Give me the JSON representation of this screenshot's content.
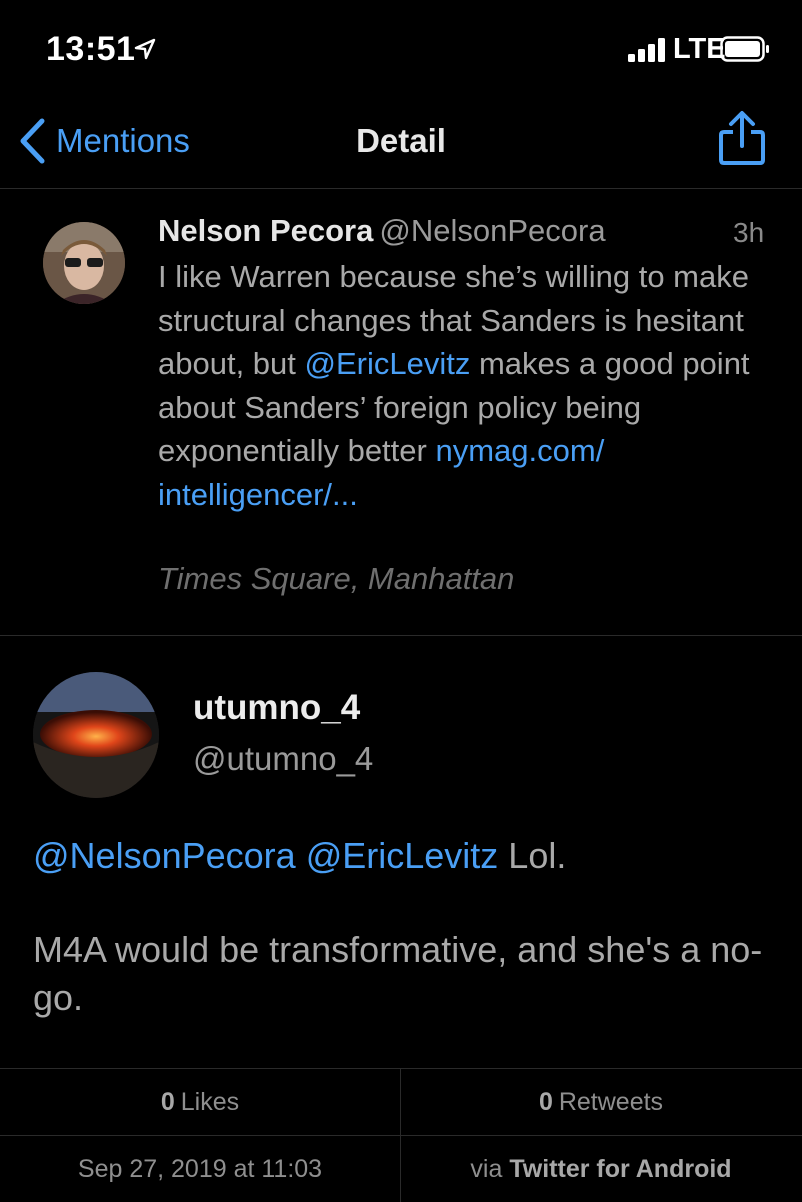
{
  "status_bar": {
    "time": "13:51",
    "network": "LTE"
  },
  "nav": {
    "back_label": "Mentions",
    "title": "Detail",
    "accent_color": "#4a9ff5"
  },
  "parent_tweet": {
    "name": "Nelson Pecora",
    "handle": "@NelsonPecora",
    "time_ago": "3h",
    "text_1": "I like Warren because she’s willing to make structural changes that Sanders is hesitant about, but ",
    "mention": "@EricLevitz",
    "text_2": " makes a good point about Sanders’ foreign policy being exponentially better ",
    "link_line_1": "nymag.com/",
    "link_line_2": "intelligencer/...",
    "location": "Times Square, Manhattan"
  },
  "reply": {
    "name": "utumno_4",
    "handle": "@utumno_4",
    "mention_1": "@NelsonPecora",
    "mention_2": "@EricLevitz",
    "line_1_text": "Lol.",
    "line_2": "M4A would be transformative, and she's a no-go."
  },
  "stats": {
    "likes_count": "0",
    "likes_label": "Likes",
    "retweets_count": "0",
    "retweets_label": "Retweets",
    "date": "Sep 27, 2019 at 11:03",
    "via_prefix": "via",
    "via_app": "Twitter for Android"
  }
}
